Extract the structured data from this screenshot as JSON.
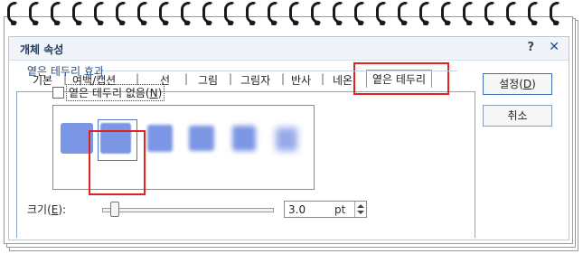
{
  "dialog": {
    "title": "개체 속성",
    "help": "?",
    "close": "✕"
  },
  "tabs": [
    {
      "label": "기본"
    },
    {
      "label": "여백/캡션"
    },
    {
      "label": "선"
    },
    {
      "label": "그림"
    },
    {
      "label": "그림자"
    },
    {
      "label": "반사"
    },
    {
      "label": "네온"
    },
    {
      "label": "옅은 테두리"
    }
  ],
  "tab_separator": "|",
  "group": {
    "title": "옅은 테두리 효과",
    "no_border_label": "옅은 테두리 없음(N)"
  },
  "preview": {
    "selected_index": 1,
    "swatch_color": "#7b96e4"
  },
  "size": {
    "label": "크기(E):",
    "value": "3.0",
    "unit": "pt"
  },
  "buttons": {
    "ok": "설정(D)",
    "cancel": "취소"
  },
  "colors": {
    "accent": "#1f4d8c",
    "highlight": "#e02222"
  }
}
